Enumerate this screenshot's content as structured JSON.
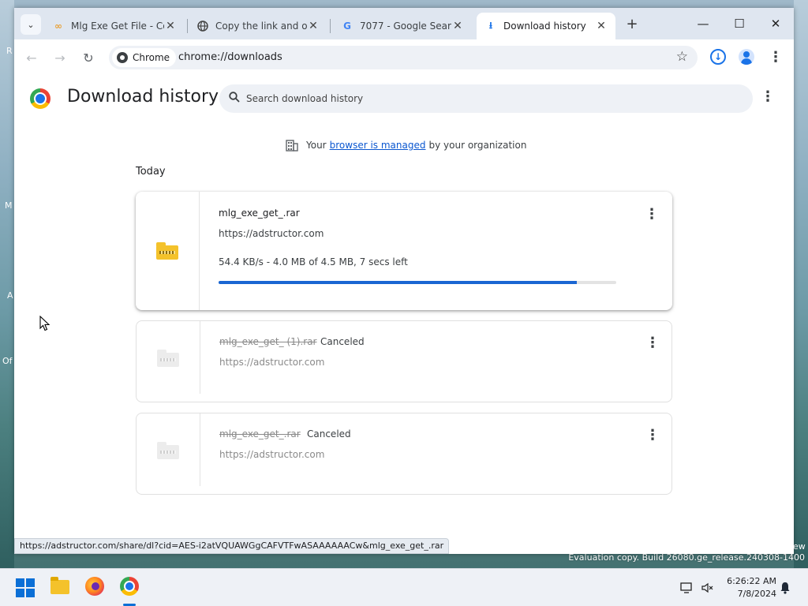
{
  "desktop": {
    "fragments": [
      "R",
      "M",
      "A",
      "Of",
      "ew"
    ],
    "evaluation_text": "Evaluation copy. Build 26080.ge_release.240308-1400"
  },
  "browser": {
    "tabs": [
      {
        "title": "Mlg Exe Get File - Co",
        "icon": "infinity-icon",
        "active": false
      },
      {
        "title": "Copy the link and op",
        "icon": "globe-icon",
        "active": false
      },
      {
        "title": "7077 - Google Search",
        "icon": "google-icon",
        "active": false
      },
      {
        "title": "Download history",
        "icon": "download-icon",
        "active": true
      }
    ],
    "new_tab_label": "+",
    "window_controls": {
      "minimize": "—",
      "maximize": "☐",
      "close": "✕"
    },
    "omnibox": {
      "chip_label": "Chrome",
      "url": "chrome://downloads"
    }
  },
  "page": {
    "title": "Download history",
    "search_placeholder": "Search download history",
    "managed": {
      "prefix": "Your",
      "link": "browser is managed",
      "suffix": "by your organization"
    },
    "date_heading": "Today",
    "downloads": [
      {
        "file_name": "mlg_exe_get_.rar",
        "source": "https://adstructor.com",
        "status": "",
        "progress_text": "54.4 KB/s - 4.0 MB of 4.5 MB, 7 secs left",
        "progress_fraction": 0.9,
        "canceled": false
      },
      {
        "file_name": "mlg_exe_get_ (1).rar",
        "source": "https://adstructor.com",
        "status": "Canceled",
        "canceled": true
      },
      {
        "file_name": "mlg_exe_get_.rar",
        "source": "https://adstructor.com",
        "status": "Canceled",
        "canceled": true
      }
    ]
  },
  "status_bar_url": "https://adstructor.com/share/dl?cid=AES-i2atVQUAWGgCAFVTFwASAAAAAACw&mlg_exe_get_.rar",
  "taskbar": {
    "time": "6:26:22 AM",
    "date": "7/8/2024"
  },
  "colors": {
    "accent": "#1a66d2",
    "link": "#0b57d0",
    "tabstrip": "#dfe6f0"
  }
}
